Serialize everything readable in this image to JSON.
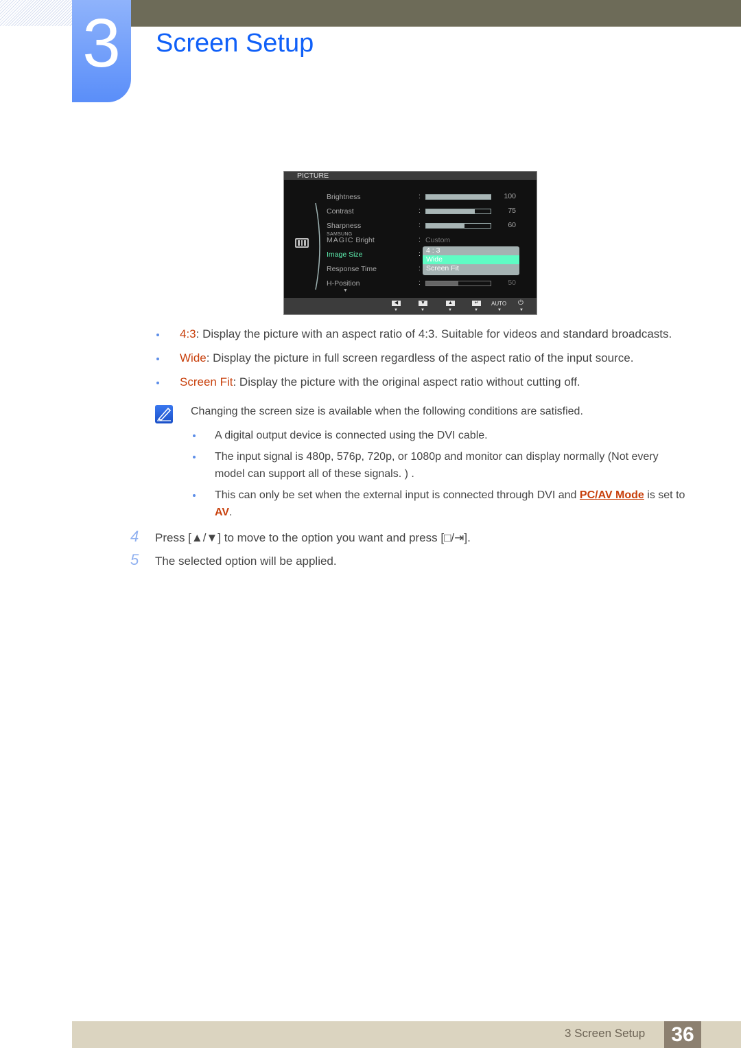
{
  "chapter": {
    "number": "3",
    "title": "Screen Setup"
  },
  "osd": {
    "header": "PICTURE",
    "items": [
      {
        "label": "Brightness",
        "value": "100",
        "level": 1.0
      },
      {
        "label": "Contrast",
        "value": "75",
        "level": 0.75
      },
      {
        "label": "Sharpness",
        "value": "60",
        "level": 0.6
      },
      {
        "label_small": "SAMSUNG",
        "label_magic": "MAGIC",
        "label": "Bright",
        "value": "Custom"
      },
      {
        "label": "Image Size",
        "active": true
      },
      {
        "label": "Response Time"
      },
      {
        "label": "H-Position",
        "value": "50",
        "level": 0.5
      }
    ],
    "dropdown": {
      "options": [
        "4 : 3",
        "Wide",
        "Screen Fit"
      ],
      "selected": "Wide"
    },
    "buttons": {
      "left": "◀",
      "down": "▼",
      "up": "▲",
      "enter": "↵",
      "auto": "AUTO",
      "power": "⏻"
    }
  },
  "bullets": [
    {
      "term": "4:3",
      "text": ": Display the picture with an aspect ratio of 4:3. Suitable for videos and standard broadcasts."
    },
    {
      "term": "Wide",
      "text": ": Display the picture in full screen regardless of the aspect ratio of the input source."
    },
    {
      "term": "Screen Fit",
      "text": ": Display the picture with the original aspect ratio without cutting off."
    }
  ],
  "note": {
    "text": "Changing the screen size is available when the following conditions are satisfied.",
    "items": [
      {
        "text": "A digital output device is connected using the DVI cable."
      },
      {
        "text": "The input signal is 480p, 576p, 720p, or 1080p and monitor can display normally (Not every model can support all of these signals. ) ."
      },
      {
        "pre": "This can only be set when the external input is connected through DVI and ",
        "link": "PC/AV Mode",
        "mid": " is set to ",
        "hl": "AV",
        "post": "."
      }
    ]
  },
  "steps": [
    {
      "num": "4",
      "pre": "Press [",
      "keys1": "▲/▼",
      "mid": "] to move to the option you want and press [",
      "keys2": "□/⇥",
      "post": "]."
    },
    {
      "num": "5",
      "text": "The selected option will be applied."
    }
  ],
  "footer": {
    "label": "3 Screen Setup",
    "page": "36"
  }
}
